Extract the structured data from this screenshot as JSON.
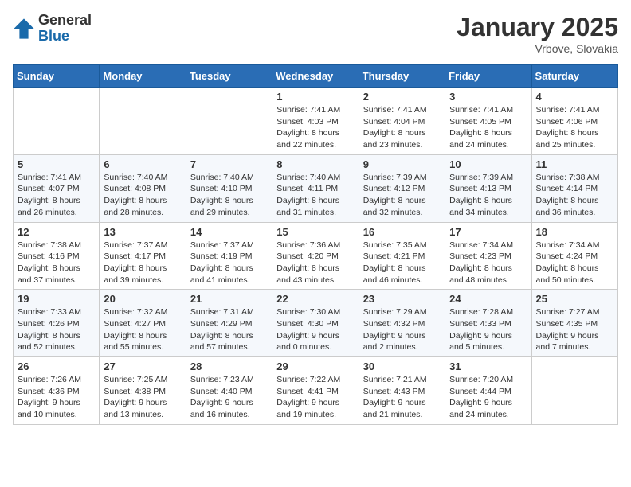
{
  "logo": {
    "general": "General",
    "blue": "Blue"
  },
  "title": "January 2025",
  "location": "Vrbove, Slovakia",
  "days_header": [
    "Sunday",
    "Monday",
    "Tuesday",
    "Wednesday",
    "Thursday",
    "Friday",
    "Saturday"
  ],
  "weeks": [
    [
      {
        "day": "",
        "info": ""
      },
      {
        "day": "",
        "info": ""
      },
      {
        "day": "",
        "info": ""
      },
      {
        "day": "1",
        "info": "Sunrise: 7:41 AM\nSunset: 4:03 PM\nDaylight: 8 hours\nand 22 minutes."
      },
      {
        "day": "2",
        "info": "Sunrise: 7:41 AM\nSunset: 4:04 PM\nDaylight: 8 hours\nand 23 minutes."
      },
      {
        "day": "3",
        "info": "Sunrise: 7:41 AM\nSunset: 4:05 PM\nDaylight: 8 hours\nand 24 minutes."
      },
      {
        "day": "4",
        "info": "Sunrise: 7:41 AM\nSunset: 4:06 PM\nDaylight: 8 hours\nand 25 minutes."
      }
    ],
    [
      {
        "day": "5",
        "info": "Sunrise: 7:41 AM\nSunset: 4:07 PM\nDaylight: 8 hours\nand 26 minutes."
      },
      {
        "day": "6",
        "info": "Sunrise: 7:40 AM\nSunset: 4:08 PM\nDaylight: 8 hours\nand 28 minutes."
      },
      {
        "day": "7",
        "info": "Sunrise: 7:40 AM\nSunset: 4:10 PM\nDaylight: 8 hours\nand 29 minutes."
      },
      {
        "day": "8",
        "info": "Sunrise: 7:40 AM\nSunset: 4:11 PM\nDaylight: 8 hours\nand 31 minutes."
      },
      {
        "day": "9",
        "info": "Sunrise: 7:39 AM\nSunset: 4:12 PM\nDaylight: 8 hours\nand 32 minutes."
      },
      {
        "day": "10",
        "info": "Sunrise: 7:39 AM\nSunset: 4:13 PM\nDaylight: 8 hours\nand 34 minutes."
      },
      {
        "day": "11",
        "info": "Sunrise: 7:38 AM\nSunset: 4:14 PM\nDaylight: 8 hours\nand 36 minutes."
      }
    ],
    [
      {
        "day": "12",
        "info": "Sunrise: 7:38 AM\nSunset: 4:16 PM\nDaylight: 8 hours\nand 37 minutes."
      },
      {
        "day": "13",
        "info": "Sunrise: 7:37 AM\nSunset: 4:17 PM\nDaylight: 8 hours\nand 39 minutes."
      },
      {
        "day": "14",
        "info": "Sunrise: 7:37 AM\nSunset: 4:19 PM\nDaylight: 8 hours\nand 41 minutes."
      },
      {
        "day": "15",
        "info": "Sunrise: 7:36 AM\nSunset: 4:20 PM\nDaylight: 8 hours\nand 43 minutes."
      },
      {
        "day": "16",
        "info": "Sunrise: 7:35 AM\nSunset: 4:21 PM\nDaylight: 8 hours\nand 46 minutes."
      },
      {
        "day": "17",
        "info": "Sunrise: 7:34 AM\nSunset: 4:23 PM\nDaylight: 8 hours\nand 48 minutes."
      },
      {
        "day": "18",
        "info": "Sunrise: 7:34 AM\nSunset: 4:24 PM\nDaylight: 8 hours\nand 50 minutes."
      }
    ],
    [
      {
        "day": "19",
        "info": "Sunrise: 7:33 AM\nSunset: 4:26 PM\nDaylight: 8 hours\nand 52 minutes."
      },
      {
        "day": "20",
        "info": "Sunrise: 7:32 AM\nSunset: 4:27 PM\nDaylight: 8 hours\nand 55 minutes."
      },
      {
        "day": "21",
        "info": "Sunrise: 7:31 AM\nSunset: 4:29 PM\nDaylight: 8 hours\nand 57 minutes."
      },
      {
        "day": "22",
        "info": "Sunrise: 7:30 AM\nSunset: 4:30 PM\nDaylight: 9 hours\nand 0 minutes."
      },
      {
        "day": "23",
        "info": "Sunrise: 7:29 AM\nSunset: 4:32 PM\nDaylight: 9 hours\nand 2 minutes."
      },
      {
        "day": "24",
        "info": "Sunrise: 7:28 AM\nSunset: 4:33 PM\nDaylight: 9 hours\nand 5 minutes."
      },
      {
        "day": "25",
        "info": "Sunrise: 7:27 AM\nSunset: 4:35 PM\nDaylight: 9 hours\nand 7 minutes."
      }
    ],
    [
      {
        "day": "26",
        "info": "Sunrise: 7:26 AM\nSunset: 4:36 PM\nDaylight: 9 hours\nand 10 minutes."
      },
      {
        "day": "27",
        "info": "Sunrise: 7:25 AM\nSunset: 4:38 PM\nDaylight: 9 hours\nand 13 minutes."
      },
      {
        "day": "28",
        "info": "Sunrise: 7:23 AM\nSunset: 4:40 PM\nDaylight: 9 hours\nand 16 minutes."
      },
      {
        "day": "29",
        "info": "Sunrise: 7:22 AM\nSunset: 4:41 PM\nDaylight: 9 hours\nand 19 minutes."
      },
      {
        "day": "30",
        "info": "Sunrise: 7:21 AM\nSunset: 4:43 PM\nDaylight: 9 hours\nand 21 minutes."
      },
      {
        "day": "31",
        "info": "Sunrise: 7:20 AM\nSunset: 4:44 PM\nDaylight: 9 hours\nand 24 minutes."
      },
      {
        "day": "",
        "info": ""
      }
    ]
  ]
}
